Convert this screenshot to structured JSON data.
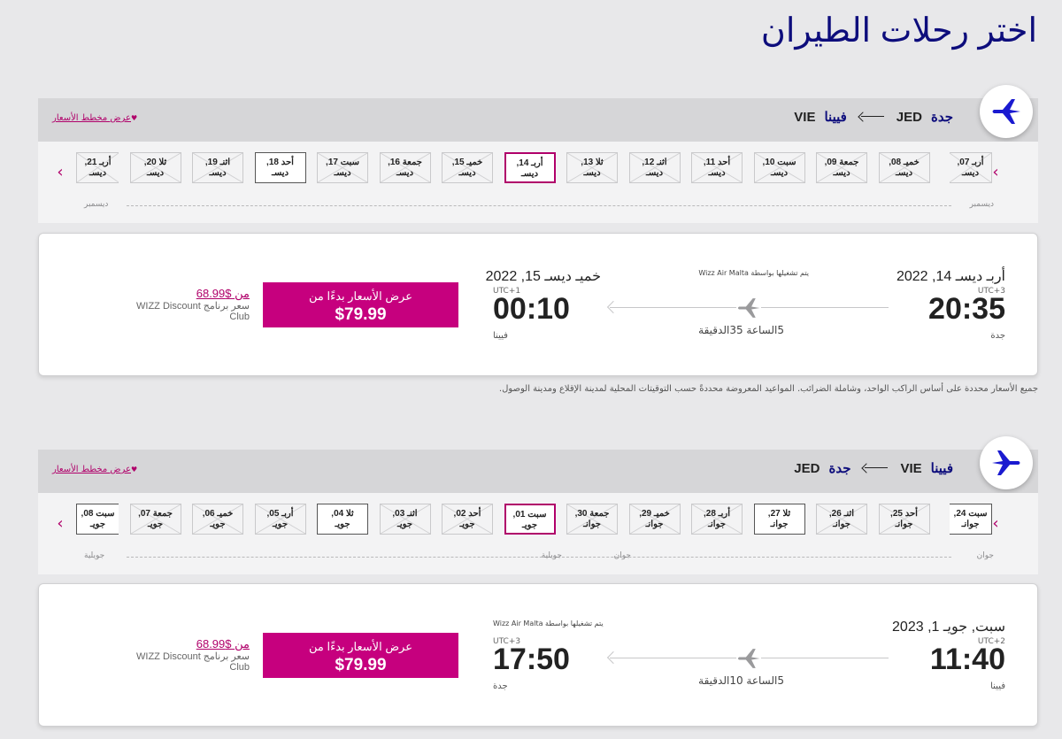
{
  "page": {
    "title": "اختر رحلات الطيران"
  },
  "outbound": {
    "origin_city": "جدة",
    "origin_code": "JED",
    "dest_city": "فيينا",
    "dest_code": "VIE",
    "price_chart_link": "عرض مخطط الأسعار",
    "dates": [
      {
        "day": "أربـ 07,",
        "month": "ديسـ",
        "status": "cut-right"
      },
      {
        "day": "خميـ 08,",
        "month": "ديسـ",
        "status": "unavailable"
      },
      {
        "day": "جمعة 09,",
        "month": "ديسـ",
        "status": "unavailable"
      },
      {
        "day": "سبت 10,",
        "month": "ديسـ",
        "status": "unavailable"
      },
      {
        "day": "أحد 11,",
        "month": "ديسـ",
        "status": "unavailable"
      },
      {
        "day": "اثنـ 12,",
        "month": "ديسـ",
        "status": "unavailable"
      },
      {
        "day": "ثلا 13,",
        "month": "ديسـ",
        "status": "unavailable"
      },
      {
        "day": "أربـ 14,",
        "month": "ديسـ",
        "status": "selected"
      },
      {
        "day": "خميـ 15,",
        "month": "ديسـ",
        "status": "unavailable"
      },
      {
        "day": "جمعة 16,",
        "month": "ديسـ",
        "status": "unavailable"
      },
      {
        "day": "سبت 17,",
        "month": "ديسـ",
        "status": "unavailable"
      },
      {
        "day": "أحد 18,",
        "month": "ديسـ",
        "status": "available"
      },
      {
        "day": "اثنـ 19,",
        "month": "ديسـ",
        "status": "unavailable"
      },
      {
        "day": "ثلا 20,",
        "month": "ديسـ",
        "status": "unavailable"
      },
      {
        "day": "أربـ 21,",
        "month": "ديسـ",
        "status": "cut"
      }
    ],
    "months": [
      "ديسمبر",
      "ديسمبر"
    ],
    "flight": {
      "dep_date": "أربـ ديسـ 14, 2022",
      "dep_utc": "UTC+3",
      "dep_time": "20:35",
      "dep_city": "جدة",
      "operated_by": "يتم تشغيلها بواسطة Wizz Air Malta",
      "duration": "5الساعة 35الدقيقة",
      "arr_date": "خميـ ديسـ 15, 2022",
      "arr_utc": "UTC+1",
      "arr_time": "00:10",
      "arr_city": "فيينا",
      "price_label": "عرض الأسعار بدءًا من",
      "price": "$79.99",
      "member_from": "من",
      "member_price": "$68.99",
      "member_program": "سعر برنامج WIZZ Discount Club"
    },
    "disclaimer": "جميع الأسعار محددة على أساس الراكب الواحد، وشاملة الضرائب. المواعيد المعروضة محددةً حسب التوقيتات المحلية لمدينة الإقلاع ومدينة الوصول."
  },
  "return": {
    "origin_city": "فيينا",
    "origin_code": "VIE",
    "dest_city": "جدة",
    "dest_code": "JED",
    "price_chart_link": "عرض مخطط الأسعار",
    "dates": [
      {
        "day": "سبت 24,",
        "month": "جوانـ",
        "status": "available-cut-right"
      },
      {
        "day": "أحد 25,",
        "month": "جوانـ",
        "status": "unavailable"
      },
      {
        "day": "اثنـ 26,",
        "month": "جوانـ",
        "status": "unavailable"
      },
      {
        "day": "ثلا 27,",
        "month": "جوانـ",
        "status": "available"
      },
      {
        "day": "أربـ 28,",
        "month": "جوانـ",
        "status": "unavailable"
      },
      {
        "day": "خميـ 29,",
        "month": "جوانـ",
        "status": "unavailable"
      },
      {
        "day": "جمعة 30,",
        "month": "جوانـ",
        "status": "unavailable"
      },
      {
        "day": "سبت 01,",
        "month": "جويـ",
        "status": "selected"
      },
      {
        "day": "أحد 02,",
        "month": "جويـ",
        "status": "unavailable"
      },
      {
        "day": "اثنـ 03,",
        "month": "جويـ",
        "status": "unavailable"
      },
      {
        "day": "ثلا 04,",
        "month": "جويـ",
        "status": "available"
      },
      {
        "day": "أربـ 05,",
        "month": "جويـ",
        "status": "unavailable"
      },
      {
        "day": "خميـ 06,",
        "month": "جويـ",
        "status": "unavailable"
      },
      {
        "day": "جمعة 07,",
        "month": "جويـ",
        "status": "unavailable"
      },
      {
        "day": "سبت 08,",
        "month": "جويـ",
        "status": "available-cut"
      }
    ],
    "months": [
      "جوان",
      "جوان",
      "جويلية",
      "جويلية"
    ],
    "flight": {
      "dep_date": "سبت, جويـ 1, 2023",
      "dep_utc": "UTC+2",
      "dep_time": "11:40",
      "dep_city": "فيينا",
      "operated_by": "يتم تشغيلها بواسطة Wizz Air Malta",
      "duration": "5الساعة 10الدقيقة",
      "arr_utc": "UTC+3",
      "arr_time": "17:50",
      "arr_city": "جدة",
      "price_label": "عرض الأسعار بدءًا من",
      "price": "$79.99",
      "member_from": "من",
      "member_price": "$68.99",
      "member_program": "سعر برنامج WIZZ Discount Club"
    }
  },
  "colors": {
    "brand_magenta": "#c6007e",
    "title_navy": "#0d0d7c",
    "plane_blue": "#1a1ad0"
  },
  "icons": {
    "route_plane": "plane-icon",
    "flight_plane": "plane-gray-icon",
    "nav": "chevron-icon"
  }
}
